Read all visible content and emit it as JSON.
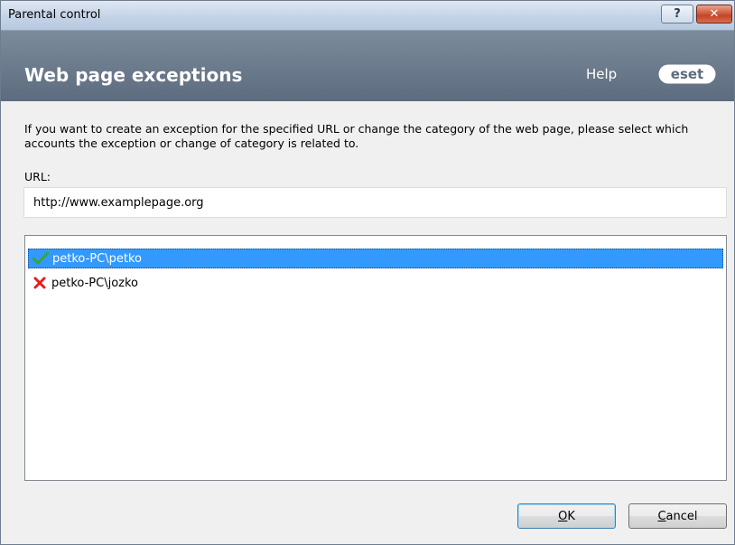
{
  "window": {
    "title": "Parental control",
    "help_button": "?",
    "close_button": "✕"
  },
  "header": {
    "title": "Web page exceptions",
    "help": "Help",
    "logo": "eset"
  },
  "content": {
    "description": "If you want to create an exception for the specified URL or change the category of the web page, please select which accounts the exception or change of category is related to.",
    "url_label": "URL:",
    "url_value": "http://www.examplepage.org"
  },
  "accounts": [
    {
      "label": "petko-PC\\petko",
      "status": "allowed",
      "icon": "check-icon",
      "selected": true
    },
    {
      "label": "petko-PC\\jozko",
      "status": "blocked",
      "icon": "cross-icon",
      "selected": false
    }
  ],
  "buttons": {
    "ok_mnemonic": "O",
    "ok_rest": "K",
    "cancel_mnemonic": "C",
    "cancel_rest": "ancel"
  },
  "colors": {
    "header": "#6b7b8d",
    "selection": "#3399ff",
    "check": "#3aa53a",
    "cross": "#e02020"
  }
}
